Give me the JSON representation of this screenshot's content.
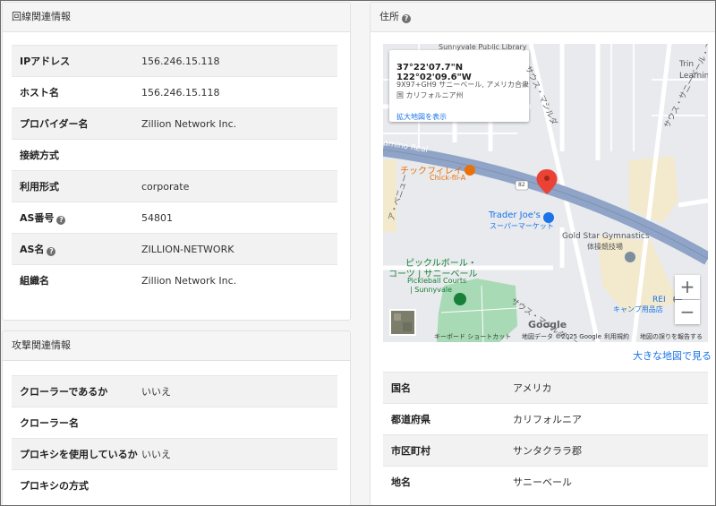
{
  "line_info": {
    "title": "回線関連情報",
    "rows": [
      {
        "key": "IPアドレス",
        "value": "156.246.15.118",
        "help": false
      },
      {
        "key": "ホスト名",
        "value": "156.246.15.118",
        "help": false
      },
      {
        "key": "プロバイダー名",
        "value": "Zillion Network Inc.",
        "help": false
      },
      {
        "key": "接続方式",
        "value": "",
        "help": false
      },
      {
        "key": "利用形式",
        "value": "corporate",
        "help": false
      },
      {
        "key": "AS番号",
        "value": "54801",
        "help": true
      },
      {
        "key": "AS名",
        "value": "ZILLION-NETWORK",
        "help": true
      },
      {
        "key": "組織名",
        "value": "Zillion Network Inc.",
        "help": false
      }
    ]
  },
  "attack_info": {
    "title": "攻撃関連情報",
    "rows": [
      {
        "key": "クローラーであるか",
        "value": "いいえ"
      },
      {
        "key": "クローラー名",
        "value": ""
      },
      {
        "key": "プロキシを使用しているか",
        "value": "いいえ"
      },
      {
        "key": "プロキシの方式",
        "value": ""
      }
    ]
  },
  "address": {
    "title": "住所",
    "help_glyph": "?",
    "map": {
      "coords": "37°22'07.7\"N 122°02'09.6\"W",
      "plus_code": "9X97+GH9 サニーベール, アメリカ合衆国 カリフォルニア州",
      "enlarge_link": "拡大地図を表示",
      "labels": {
        "library": "Sunnyvale Public Library",
        "road_left": "amino Real",
        "chick_ja": "チックフィレイ",
        "chick_en": "Chick-fil-A",
        "route": "82",
        "tj_en": "Trader Joe's",
        "tj_ja": "スーパーマーケット",
        "gym_en": "Gold Star Gymnastics",
        "gym_ja": "体操競技場",
        "pickle_ja1": "ピックルボール・",
        "pickle_ja2": "コーツ | サニーベール",
        "pickle_en1": "Pickleball Courts",
        "pickle_en2": "| Sunnyvale",
        "rei": "REI",
        "rei_ja": "キャンプ用品店",
        "street_s1": "サウス・マシルダ・アベ",
        "street_s2": "サウス・マシルダ",
        "street_n": "サウス・サニーベール・アベニュー",
        "street_w": "ア・ベニュー",
        "trin": "Trin",
        "learn": "Learnin",
        "google": "Google"
      },
      "zoom_in": "+",
      "zoom_out": "−",
      "attribution": {
        "shortcuts": "キーボード ショートカット",
        "data": "地図データ ©2025 Google",
        "terms": "利用規約",
        "report": "地図の誤りを報告する"
      }
    },
    "big_map_link": "大きな地図で見る",
    "rows": [
      {
        "key": "国名",
        "value": "アメリカ"
      },
      {
        "key": "都道府県",
        "value": "カリフォルニア"
      },
      {
        "key": "市区町村",
        "value": "サンタクララ郡"
      },
      {
        "key": "地名",
        "value": "サニーベール"
      }
    ]
  },
  "colors": {
    "road_blue": "#8fa4c6",
    "park_green": "#a8dab5",
    "marker_red": "#ea4335",
    "poi_orange": "#e8710a",
    "poi_blue": "#1a73e8",
    "poi_green": "#188038",
    "link_blue": "#1a73e8"
  }
}
